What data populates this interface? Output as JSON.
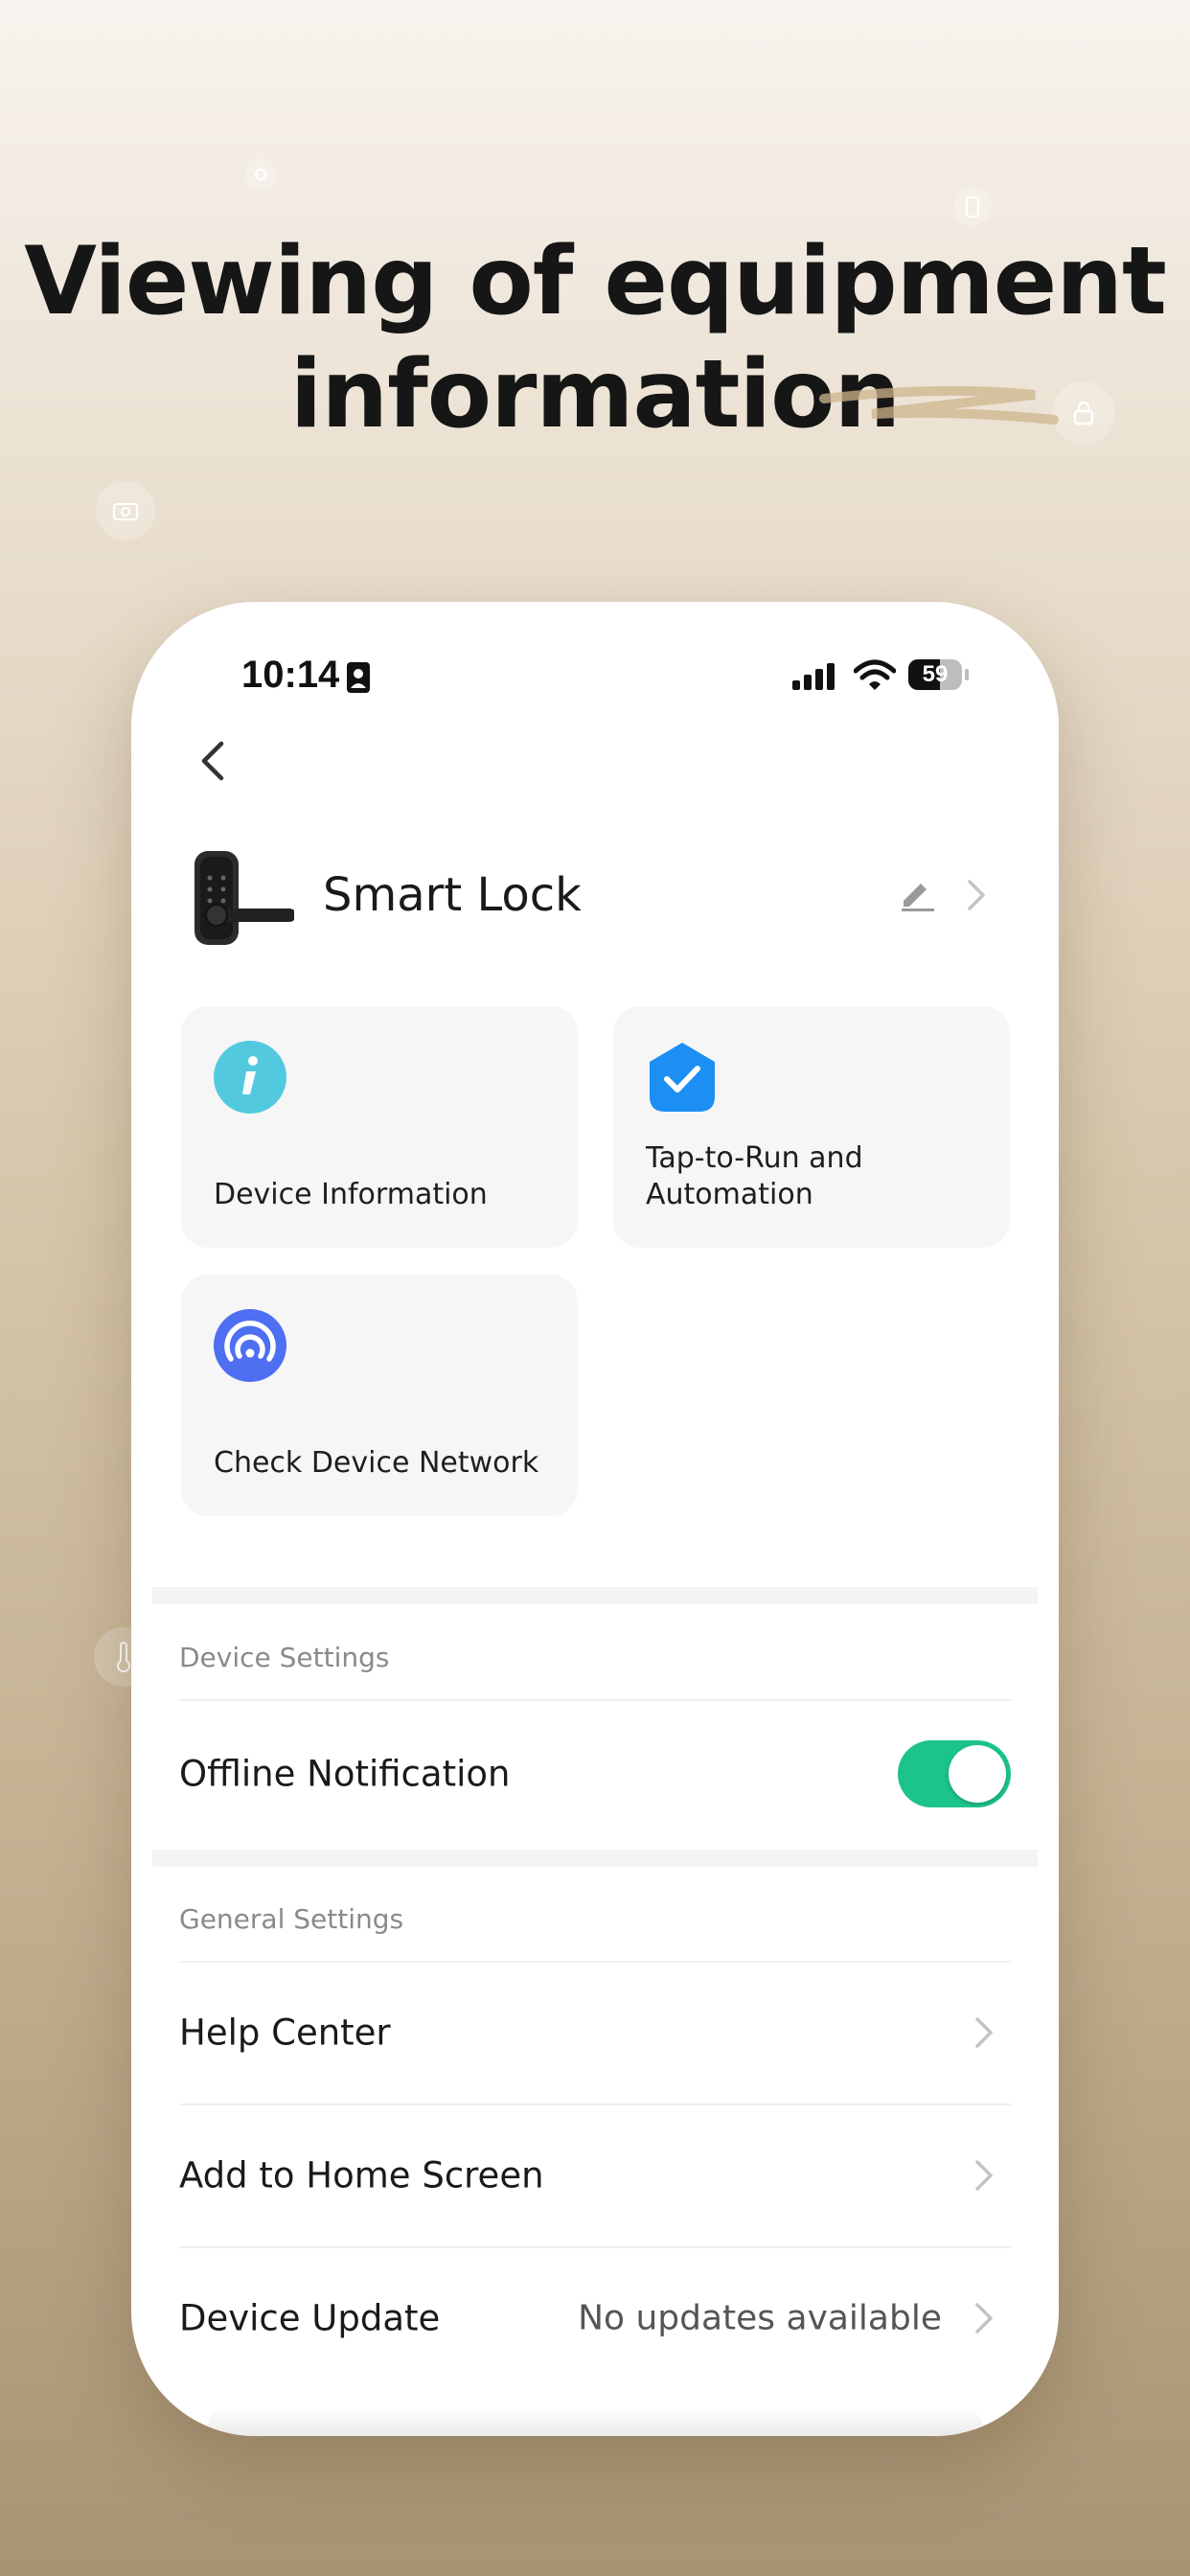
{
  "headline": {
    "line1": "Viewing of equipment",
    "line2": "information"
  },
  "status_bar": {
    "time": "10:14",
    "battery": "59",
    "battery_level": 0.59
  },
  "device": {
    "name": "Smart Lock"
  },
  "cards": [
    {
      "label": "Device Information",
      "icon": "info-icon",
      "color": "#53c9df"
    },
    {
      "label": "Tap-to-Run and Automation",
      "icon": "automation-check-icon",
      "color": "#1b8ff3"
    },
    {
      "label": "Check Device Network",
      "icon": "network-signal-icon",
      "color": "#4e6ff2"
    }
  ],
  "device_settings": {
    "title": "Device Settings",
    "offline_notification": {
      "label": "Offline Notification",
      "enabled": true
    }
  },
  "general_settings": {
    "title": "General Settings",
    "items": [
      {
        "label": "Help Center",
        "value": ""
      },
      {
        "label": "Add to Home Screen",
        "value": ""
      },
      {
        "label": "Device Update",
        "value": "No updates available"
      }
    ]
  },
  "colors": {
    "toggle_on": "#1cc48a",
    "card_bg": "#f6f6f6",
    "headline": "#161616"
  }
}
